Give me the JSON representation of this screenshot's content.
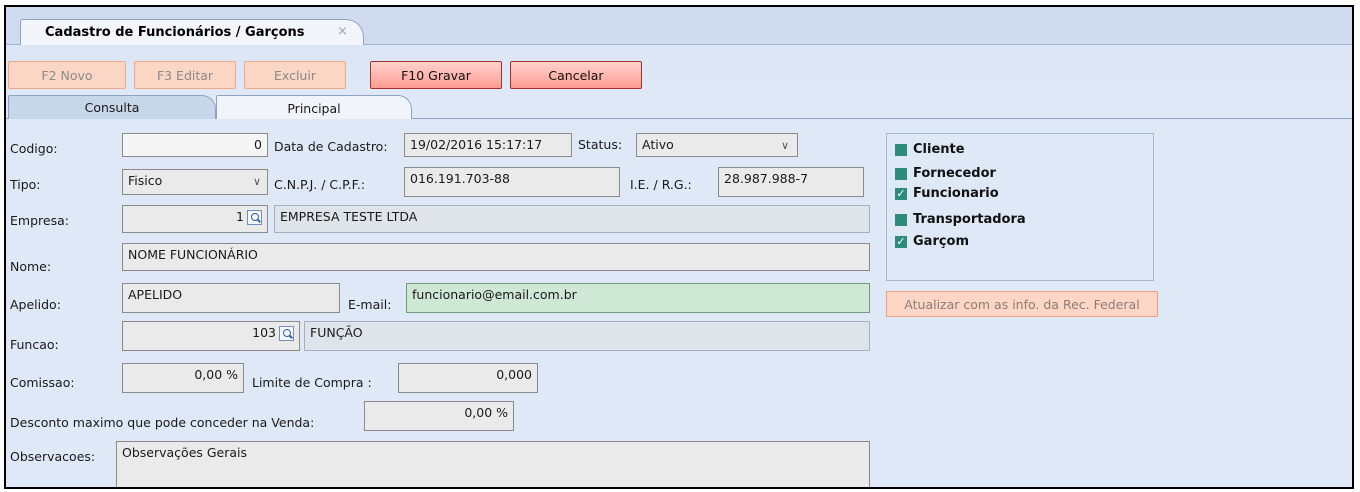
{
  "window": {
    "tab_title": "Cadastro de Funcionários / Garçons",
    "tab_close": "×"
  },
  "toolbar": {
    "novo": "F2 Novo",
    "editar": "F3 Editar",
    "excluir": "Excluir",
    "gravar": "F10 Gravar",
    "cancelar": "Cancelar"
  },
  "tabs": {
    "consulta": "Consulta",
    "principal": "Principal"
  },
  "form": {
    "codigo_label": "Codigo:",
    "codigo_value": "0",
    "data_cadastro_label": "Data de Cadastro:",
    "data_cadastro_value": "19/02/2016 15:17:17",
    "status_label": "Status:",
    "status_value": "Ativo",
    "tipo_label": "Tipo:",
    "tipo_value": "Fisico",
    "cnpj_label": "C.N.P.J. / C.P.F.:",
    "cnpj_value": "016.191.703-88",
    "ie_label": "I.E. / R.G.:",
    "ie_value": "28.987.988-7",
    "empresa_label": "Empresa:",
    "empresa_code": "1",
    "empresa_name": "EMPRESA TESTE LTDA",
    "nome_label": "Nome:",
    "nome_value": "NOME FUNCIONÁRIO",
    "apelido_label": "Apelido:",
    "apelido_value": "APELIDO",
    "email_label": "E-mail:",
    "email_value": "funcionario@email.com.br",
    "funcao_label": "Funcao:",
    "funcao_code": "103",
    "funcao_name": "FUNÇÃO",
    "comissao_label": "Comissao:",
    "comissao_value": "0,00 %",
    "limite_label": "Limite de Compra :",
    "limite_value": "0,000",
    "desconto_label": "Desconto maximo que pode conceder na Venda:",
    "desconto_value": "0,00 %",
    "observacoes_label": "Observacoes:",
    "observacoes_value": "Observações Gerais"
  },
  "roles": [
    {
      "label": "Cliente",
      "checked": false
    },
    {
      "label": "Fornecedor",
      "checked": false
    },
    {
      "label": "Funcionario",
      "checked": true
    },
    {
      "label": "Transportadora",
      "checked": false
    },
    {
      "label": "Garçom",
      "checked": true
    }
  ],
  "federal_button": "Atualizar com as info. da Rec. Federal"
}
